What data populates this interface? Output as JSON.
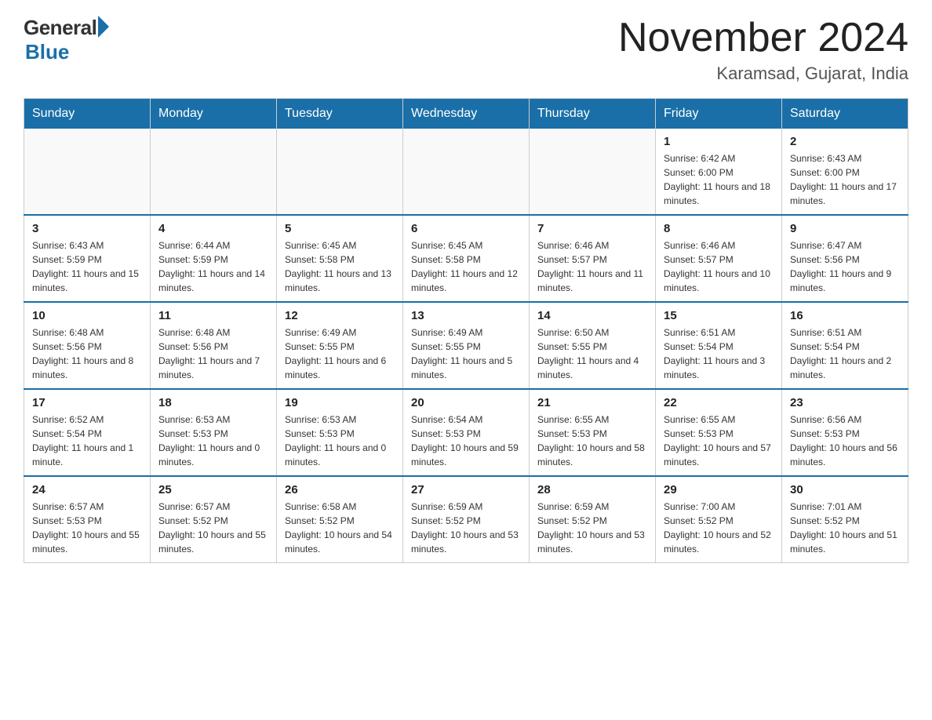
{
  "header": {
    "logo_general": "General",
    "logo_blue": "Blue",
    "month_title": "November 2024",
    "location": "Karamsad, Gujarat, India"
  },
  "days_of_week": [
    "Sunday",
    "Monday",
    "Tuesday",
    "Wednesday",
    "Thursday",
    "Friday",
    "Saturday"
  ],
  "weeks": [
    [
      {
        "day": "",
        "sunrise": "",
        "sunset": "",
        "daylight": ""
      },
      {
        "day": "",
        "sunrise": "",
        "sunset": "",
        "daylight": ""
      },
      {
        "day": "",
        "sunrise": "",
        "sunset": "",
        "daylight": ""
      },
      {
        "day": "",
        "sunrise": "",
        "sunset": "",
        "daylight": ""
      },
      {
        "day": "",
        "sunrise": "",
        "sunset": "",
        "daylight": ""
      },
      {
        "day": "1",
        "sunrise": "Sunrise: 6:42 AM",
        "sunset": "Sunset: 6:00 PM",
        "daylight": "Daylight: 11 hours and 18 minutes."
      },
      {
        "day": "2",
        "sunrise": "Sunrise: 6:43 AM",
        "sunset": "Sunset: 6:00 PM",
        "daylight": "Daylight: 11 hours and 17 minutes."
      }
    ],
    [
      {
        "day": "3",
        "sunrise": "Sunrise: 6:43 AM",
        "sunset": "Sunset: 5:59 PM",
        "daylight": "Daylight: 11 hours and 15 minutes."
      },
      {
        "day": "4",
        "sunrise": "Sunrise: 6:44 AM",
        "sunset": "Sunset: 5:59 PM",
        "daylight": "Daylight: 11 hours and 14 minutes."
      },
      {
        "day": "5",
        "sunrise": "Sunrise: 6:45 AM",
        "sunset": "Sunset: 5:58 PM",
        "daylight": "Daylight: 11 hours and 13 minutes."
      },
      {
        "day": "6",
        "sunrise": "Sunrise: 6:45 AM",
        "sunset": "Sunset: 5:58 PM",
        "daylight": "Daylight: 11 hours and 12 minutes."
      },
      {
        "day": "7",
        "sunrise": "Sunrise: 6:46 AM",
        "sunset": "Sunset: 5:57 PM",
        "daylight": "Daylight: 11 hours and 11 minutes."
      },
      {
        "day": "8",
        "sunrise": "Sunrise: 6:46 AM",
        "sunset": "Sunset: 5:57 PM",
        "daylight": "Daylight: 11 hours and 10 minutes."
      },
      {
        "day": "9",
        "sunrise": "Sunrise: 6:47 AM",
        "sunset": "Sunset: 5:56 PM",
        "daylight": "Daylight: 11 hours and 9 minutes."
      }
    ],
    [
      {
        "day": "10",
        "sunrise": "Sunrise: 6:48 AM",
        "sunset": "Sunset: 5:56 PM",
        "daylight": "Daylight: 11 hours and 8 minutes."
      },
      {
        "day": "11",
        "sunrise": "Sunrise: 6:48 AM",
        "sunset": "Sunset: 5:56 PM",
        "daylight": "Daylight: 11 hours and 7 minutes."
      },
      {
        "day": "12",
        "sunrise": "Sunrise: 6:49 AM",
        "sunset": "Sunset: 5:55 PM",
        "daylight": "Daylight: 11 hours and 6 minutes."
      },
      {
        "day": "13",
        "sunrise": "Sunrise: 6:49 AM",
        "sunset": "Sunset: 5:55 PM",
        "daylight": "Daylight: 11 hours and 5 minutes."
      },
      {
        "day": "14",
        "sunrise": "Sunrise: 6:50 AM",
        "sunset": "Sunset: 5:55 PM",
        "daylight": "Daylight: 11 hours and 4 minutes."
      },
      {
        "day": "15",
        "sunrise": "Sunrise: 6:51 AM",
        "sunset": "Sunset: 5:54 PM",
        "daylight": "Daylight: 11 hours and 3 minutes."
      },
      {
        "day": "16",
        "sunrise": "Sunrise: 6:51 AM",
        "sunset": "Sunset: 5:54 PM",
        "daylight": "Daylight: 11 hours and 2 minutes."
      }
    ],
    [
      {
        "day": "17",
        "sunrise": "Sunrise: 6:52 AM",
        "sunset": "Sunset: 5:54 PM",
        "daylight": "Daylight: 11 hours and 1 minute."
      },
      {
        "day": "18",
        "sunrise": "Sunrise: 6:53 AM",
        "sunset": "Sunset: 5:53 PM",
        "daylight": "Daylight: 11 hours and 0 minutes."
      },
      {
        "day": "19",
        "sunrise": "Sunrise: 6:53 AM",
        "sunset": "Sunset: 5:53 PM",
        "daylight": "Daylight: 11 hours and 0 minutes."
      },
      {
        "day": "20",
        "sunrise": "Sunrise: 6:54 AM",
        "sunset": "Sunset: 5:53 PM",
        "daylight": "Daylight: 10 hours and 59 minutes."
      },
      {
        "day": "21",
        "sunrise": "Sunrise: 6:55 AM",
        "sunset": "Sunset: 5:53 PM",
        "daylight": "Daylight: 10 hours and 58 minutes."
      },
      {
        "day": "22",
        "sunrise": "Sunrise: 6:55 AM",
        "sunset": "Sunset: 5:53 PM",
        "daylight": "Daylight: 10 hours and 57 minutes."
      },
      {
        "day": "23",
        "sunrise": "Sunrise: 6:56 AM",
        "sunset": "Sunset: 5:53 PM",
        "daylight": "Daylight: 10 hours and 56 minutes."
      }
    ],
    [
      {
        "day": "24",
        "sunrise": "Sunrise: 6:57 AM",
        "sunset": "Sunset: 5:53 PM",
        "daylight": "Daylight: 10 hours and 55 minutes."
      },
      {
        "day": "25",
        "sunrise": "Sunrise: 6:57 AM",
        "sunset": "Sunset: 5:52 PM",
        "daylight": "Daylight: 10 hours and 55 minutes."
      },
      {
        "day": "26",
        "sunrise": "Sunrise: 6:58 AM",
        "sunset": "Sunset: 5:52 PM",
        "daylight": "Daylight: 10 hours and 54 minutes."
      },
      {
        "day": "27",
        "sunrise": "Sunrise: 6:59 AM",
        "sunset": "Sunset: 5:52 PM",
        "daylight": "Daylight: 10 hours and 53 minutes."
      },
      {
        "day": "28",
        "sunrise": "Sunrise: 6:59 AM",
        "sunset": "Sunset: 5:52 PM",
        "daylight": "Daylight: 10 hours and 53 minutes."
      },
      {
        "day": "29",
        "sunrise": "Sunrise: 7:00 AM",
        "sunset": "Sunset: 5:52 PM",
        "daylight": "Daylight: 10 hours and 52 minutes."
      },
      {
        "day": "30",
        "sunrise": "Sunrise: 7:01 AM",
        "sunset": "Sunset: 5:52 PM",
        "daylight": "Daylight: 10 hours and 51 minutes."
      }
    ]
  ]
}
